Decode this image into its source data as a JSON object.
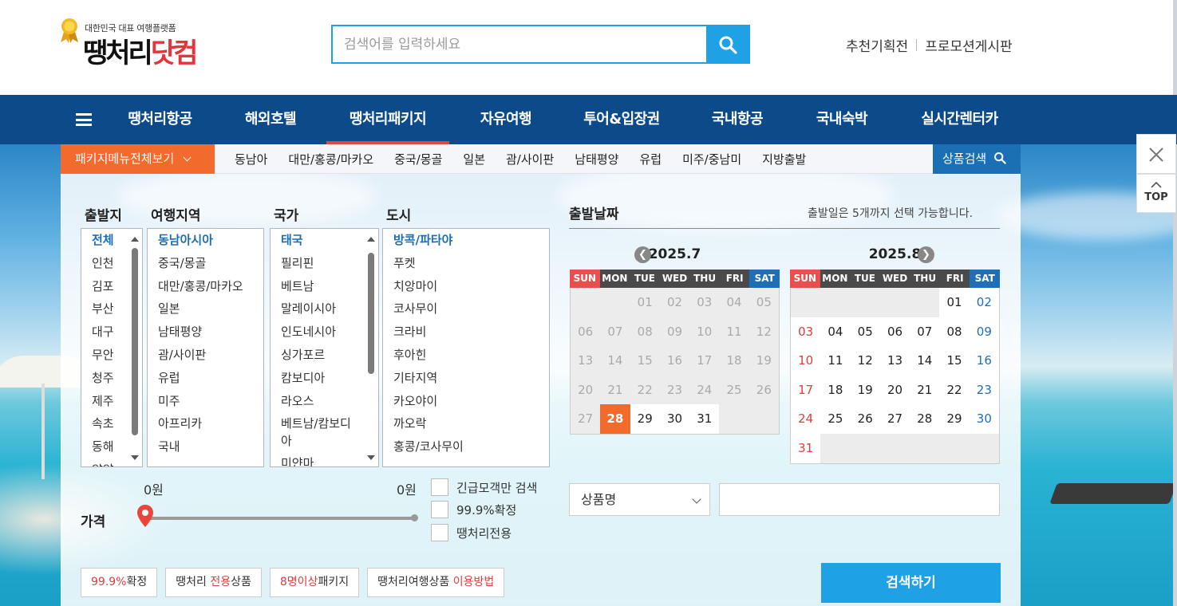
{
  "header": {
    "logo_tagline": "대한민국 대표 여행플랫폼",
    "logo_text_main": "땡처리",
    "logo_text_com": "닷컴",
    "search_placeholder": "검색어를 입력하세요",
    "top_links": [
      "추천기획전",
      "프로모션게시판"
    ]
  },
  "gnb": {
    "items": [
      "땡처리항공",
      "해외호텔",
      "땡처리패키지",
      "자유여행",
      "투어&입장권",
      "국내항공",
      "국내숙박",
      "실시간렌터카"
    ],
    "active": "땡처리패키지"
  },
  "subnav": {
    "menu_all": "패키지메뉴전체보기",
    "links": [
      "동남아",
      "대만/홍콩/마카오",
      "중국/몽골",
      "일본",
      "괌/사이판",
      "남태평양",
      "유럽",
      "미주/중남미",
      "지방출발"
    ],
    "product_search": "상품검색"
  },
  "filters": {
    "departure": {
      "label": "출발지",
      "items": [
        "전체",
        "인천",
        "김포",
        "부산",
        "대구",
        "무안",
        "청주",
        "제주",
        "속초",
        "동해",
        "양양"
      ],
      "selected": "전체"
    },
    "region": {
      "label": "여행지역",
      "items": [
        "동남아시아",
        "중국/몽골",
        "대만/홍콩/마카오",
        "일본",
        "남태평양",
        "괌/사이판",
        "유럽",
        "미주",
        "아프리카",
        "국내"
      ],
      "selected": "동남아시아"
    },
    "country": {
      "label": "국가",
      "items": [
        "태국",
        "필리핀",
        "베트남",
        "말레이시아",
        "인도네시아",
        "싱가포르",
        "캄보디아",
        "라오스",
        "베트남/캄보디아",
        "미얀마"
      ],
      "selected": "태국"
    },
    "city": {
      "label": "도시",
      "items": [
        "방콕/파타야",
        "푸켓",
        "치앙마이",
        "코사무이",
        "크라비",
        "후아힌",
        "기타지역",
        "카오야이",
        "까오락",
        "홍콩/코사무이"
      ],
      "selected": "방콕/파타야"
    }
  },
  "date": {
    "title": "출발날짜",
    "note": "출발일은 5개까지 선택 가능합니다.",
    "weekdays": [
      "SUN",
      "MON",
      "TUE",
      "WED",
      "THU",
      "FRI",
      "SAT"
    ],
    "prev_icon": "chevron-left-icon",
    "next_icon": "chevron-right-icon",
    "months": [
      {
        "title": "2025.7",
        "offset": 2,
        "days": 31,
        "past_until": 27,
        "today": 28
      },
      {
        "title": "2025.8",
        "offset": 5,
        "days": 31,
        "past_until": 0,
        "today": 0
      }
    ]
  },
  "price": {
    "label": "가격",
    "min": "0원",
    "max": "0원"
  },
  "options": [
    "긴급모객만 검색",
    "99.9%확정",
    "땡처리전용"
  ],
  "product_select": {
    "value": "상품명"
  },
  "chips": [
    {
      "hl": "99.9%",
      "rest": "확정",
      "hl_first": true
    },
    {
      "pre": "땡처리 ",
      "hl": "전용",
      "rest": "상품"
    },
    {
      "hl": "8명이상",
      "rest": "패키지",
      "hl_first": true
    },
    {
      "pre": "땡처리여행상품 ",
      "hl": "이용방법",
      "rest": ""
    }
  ],
  "search_button": "검색하기",
  "side": {
    "close_icon": "close-icon",
    "top_label": "TOP"
  },
  "colors": {
    "nav_bg": "#0d4a8a",
    "accent_orange": "#f26b2c",
    "accent_blue": "#1fa1e6",
    "sunday_red": "#e03c3c",
    "saturday_blue": "#1f6fb8"
  }
}
